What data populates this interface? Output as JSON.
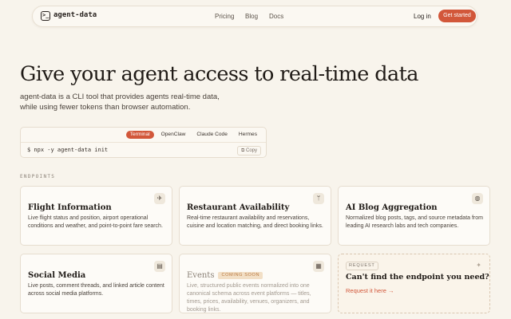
{
  "nav": {
    "logo_glyph": ">_",
    "brand": "agent-data",
    "links": [
      "Pricing",
      "Blog",
      "Docs"
    ],
    "login": "Log in",
    "cta": "Get started"
  },
  "hero": {
    "title": "Give your agent access to real-time data",
    "subtitle_line1": "agent-data is a CLI tool that provides agents real-time data,",
    "subtitle_line2": "while using fewer tokens than browser automation."
  },
  "terminal": {
    "tabs": [
      "Terminal",
      "OpenClaw",
      "Claude Code",
      "Hermes"
    ],
    "active_tab": "Terminal",
    "command": "$ npx -y agent-data init",
    "copy_label": "Copy"
  },
  "section_label": "ENDPOINTS",
  "cards": [
    {
      "title": "Flight Information",
      "desc": "Live flight status and position, airport operational conditions and weather, and point-to-point fare search.",
      "icon": "plane-icon"
    },
    {
      "title": "Restaurant Availability",
      "desc": "Real-time restaurant availability and reservations, cuisine and location matching, and direct booking links.",
      "icon": "utensils-icon"
    },
    {
      "title": "AI Blog Aggregation",
      "desc": "Normalized blog posts, tags, and source metadata from leading AI research labs and tech companies.",
      "icon": "globe-icon"
    },
    {
      "title": "Social Media",
      "desc": "Live posts, comment threads, and linked article content across social media platforms.",
      "icon": "chat-icon"
    },
    {
      "title": "Events",
      "badge": "COMING SOON",
      "desc": "Live, structured public events normalized into one canonical schema across event platforms — titles, times, prices, availability, venues, organizers, and booking links.",
      "icon": "calendar-icon"
    }
  ],
  "request_card": {
    "label": "REQUEST",
    "title": "Can't find the endpoint you need?",
    "link": "Request it here →"
  },
  "colors": {
    "accent": "#d2573a",
    "background": "#f8f4ec"
  }
}
